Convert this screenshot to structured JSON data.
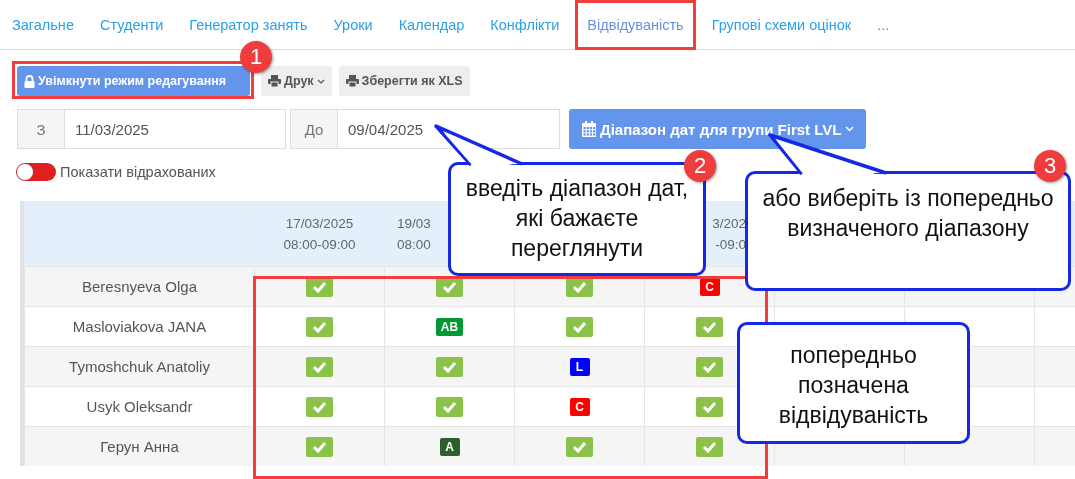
{
  "tabs": [
    {
      "label": "Загальне",
      "selected": false
    },
    {
      "label": "Студенти",
      "selected": false
    },
    {
      "label": "Генератор занять",
      "selected": false
    },
    {
      "label": "Уроки",
      "selected": false
    },
    {
      "label": "Календар",
      "selected": false
    },
    {
      "label": "Конфлікти",
      "selected": false
    },
    {
      "label": "Відвідуваність",
      "selected": true
    },
    {
      "label": "Групові схеми оцінок",
      "selected": false
    },
    {
      "label": "...",
      "selected": false
    }
  ],
  "toolbar": {
    "edit_button": "Увімкнути режим редагування",
    "print_button": "Друк",
    "xls_button": "Зберегти як XLS"
  },
  "date_range": {
    "from_label": "З",
    "from_value": "11/03/2025",
    "to_label": "До",
    "to_value": "09/04/2025",
    "preset_button": "Діапазон дат для групи First LVL"
  },
  "show_expelled": {
    "label": "Показати відрахованих",
    "on": false
  },
  "table": {
    "columns": [
      {
        "date": "17/03/2025",
        "time": "08:00-09:00",
        "cut_at_left": false,
        "cut_at_right": false
      },
      {
        "date": "19/03",
        "time": "08:00",
        "cut_at_left": false,
        "cut_at_right": true
      },
      {},
      {
        "date": "3/202",
        "time": "-09:0",
        "cut_at_left": true,
        "cut_at_right": true
      },
      {},
      {},
      {}
    ],
    "rows": [
      {
        "name": "Beresnyeva Olga",
        "marks": [
          {
            "kind": "check"
          },
          {
            "kind": "check"
          },
          {
            "kind": "check"
          },
          {
            "kind": "code",
            "code": "C",
            "color": "#ff0000"
          }
        ]
      },
      {
        "name": "Masloviakova JANA",
        "marks": [
          {
            "kind": "check"
          },
          {
            "kind": "code",
            "code": "AB",
            "color": "#009933"
          },
          {
            "kind": "check"
          },
          {
            "kind": "check"
          }
        ]
      },
      {
        "name": "Tymoshchuk Anatoliy",
        "marks": [
          {
            "kind": "check"
          },
          {
            "kind": "check"
          },
          {
            "kind": "code",
            "code": "L",
            "color": "#0000ff"
          },
          {
            "kind": "check"
          }
        ]
      },
      {
        "name": "Usyk Oleksandr",
        "marks": [
          {
            "kind": "check"
          },
          {
            "kind": "check"
          },
          {
            "kind": "code",
            "code": "C",
            "color": "#ff0000"
          },
          {
            "kind": "check"
          }
        ]
      },
      {
        "name": "Герун Анна",
        "marks": [
          {
            "kind": "check"
          },
          {
            "kind": "code",
            "code": "A",
            "color": "#2d5f2d"
          },
          {
            "kind": "check"
          },
          {
            "kind": "check"
          }
        ]
      }
    ]
  },
  "annotations": [
    {
      "number": "1"
    },
    {
      "number": "2",
      "text": "введіть діапазон дат, які бажаєте переглянути"
    },
    {
      "number": "3",
      "text": "або виберіть із попередньо визначеного діапазону"
    },
    {
      "text": "попередньо позначена відвідуваність"
    }
  ]
}
